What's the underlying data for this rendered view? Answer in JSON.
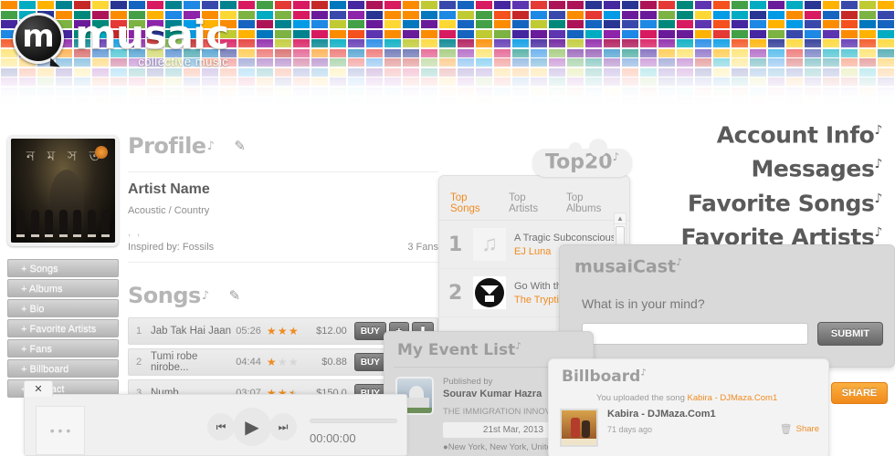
{
  "brand": {
    "name": "musaic",
    "tagline": "collective music",
    "monogram": "m"
  },
  "right_nav": [
    {
      "label": "Account Info"
    },
    {
      "label": "Messages"
    },
    {
      "label": "Favorite Songs"
    },
    {
      "label": "Favorite Artists"
    }
  ],
  "sidebar": {
    "menu": [
      {
        "label": "+ Songs"
      },
      {
        "label": "+ Albums"
      },
      {
        "label": "+ Bio"
      },
      {
        "label": "+ Favorite Artists"
      },
      {
        "label": "+ Fans"
      },
      {
        "label": "+ Billboard"
      },
      {
        "label": "+ Contact"
      }
    ]
  },
  "profile": {
    "heading": "Profile",
    "artist_name": "Artist Name",
    "genre": "Acoustic / Country",
    "location": ", ,",
    "inspired_by": "Inspired by: Fossils",
    "fans": "3 Fans"
  },
  "songs_panel": {
    "heading": "Songs",
    "buy_label": "BUY",
    "add_icon": "+",
    "download_icon": "⬇",
    "rows": [
      {
        "num": "1",
        "title": "Jab Tak Hai Jaan",
        "duration": "05:26",
        "rating": 3,
        "price": "$12.00"
      },
      {
        "num": "2",
        "title": "Tumi robe nirobe...",
        "duration": "04:44",
        "rating": 1,
        "price": "$0.88"
      },
      {
        "num": "3",
        "title": "Numb",
        "duration": "03:07",
        "rating": 2.5,
        "price": "$150.0"
      }
    ]
  },
  "top20": {
    "label": "Top20",
    "tabs": [
      {
        "label": "Top Songs",
        "active": true
      },
      {
        "label": "Top Artists",
        "active": false
      },
      {
        "label": "Top Albums",
        "active": false
      }
    ],
    "entries": [
      {
        "rank": "1",
        "title": "A Tragic Subconscious",
        "artist": "EJ Luna",
        "art": "music-note"
      },
      {
        "rank": "2",
        "title": "Go With the",
        "artist": "The Tryptics",
        "art": "circle-logo"
      }
    ]
  },
  "musaicast": {
    "title": "musaiCast",
    "prompt": "What is in your mind?",
    "input_value": "",
    "input_placeholder": "",
    "submit_label": "SUBMIT"
  },
  "event_list": {
    "title": "My Event List",
    "published_by_label": "Published by",
    "publisher": "Sourav Kumar Hazra",
    "description": "THE IMMIGRATION INNOVATION A...",
    "date": "21st Mar, 2013",
    "location": "New York, New York, United State..."
  },
  "billboard": {
    "title": "Billboard",
    "activity_prefix": "You uploaded the song ",
    "activity_link": "Kabira - DJMaza.Com1",
    "item_title": "Kabira - DJMaza.Com1",
    "item_age": "71 days ago",
    "share_link": "Share",
    "share_button": "SHARE"
  },
  "player": {
    "close_icon": "✕",
    "thumb_placeholder": "• • •",
    "prev_icon": "⏮",
    "play_icon": "▶",
    "next_icon": "⏭",
    "time": "00:00:00"
  },
  "colors": {
    "accent": "#f08c22",
    "panel_gray": "#d9d9d9",
    "text_gray": "#6f6f6f"
  },
  "note_glyph": "♪"
}
